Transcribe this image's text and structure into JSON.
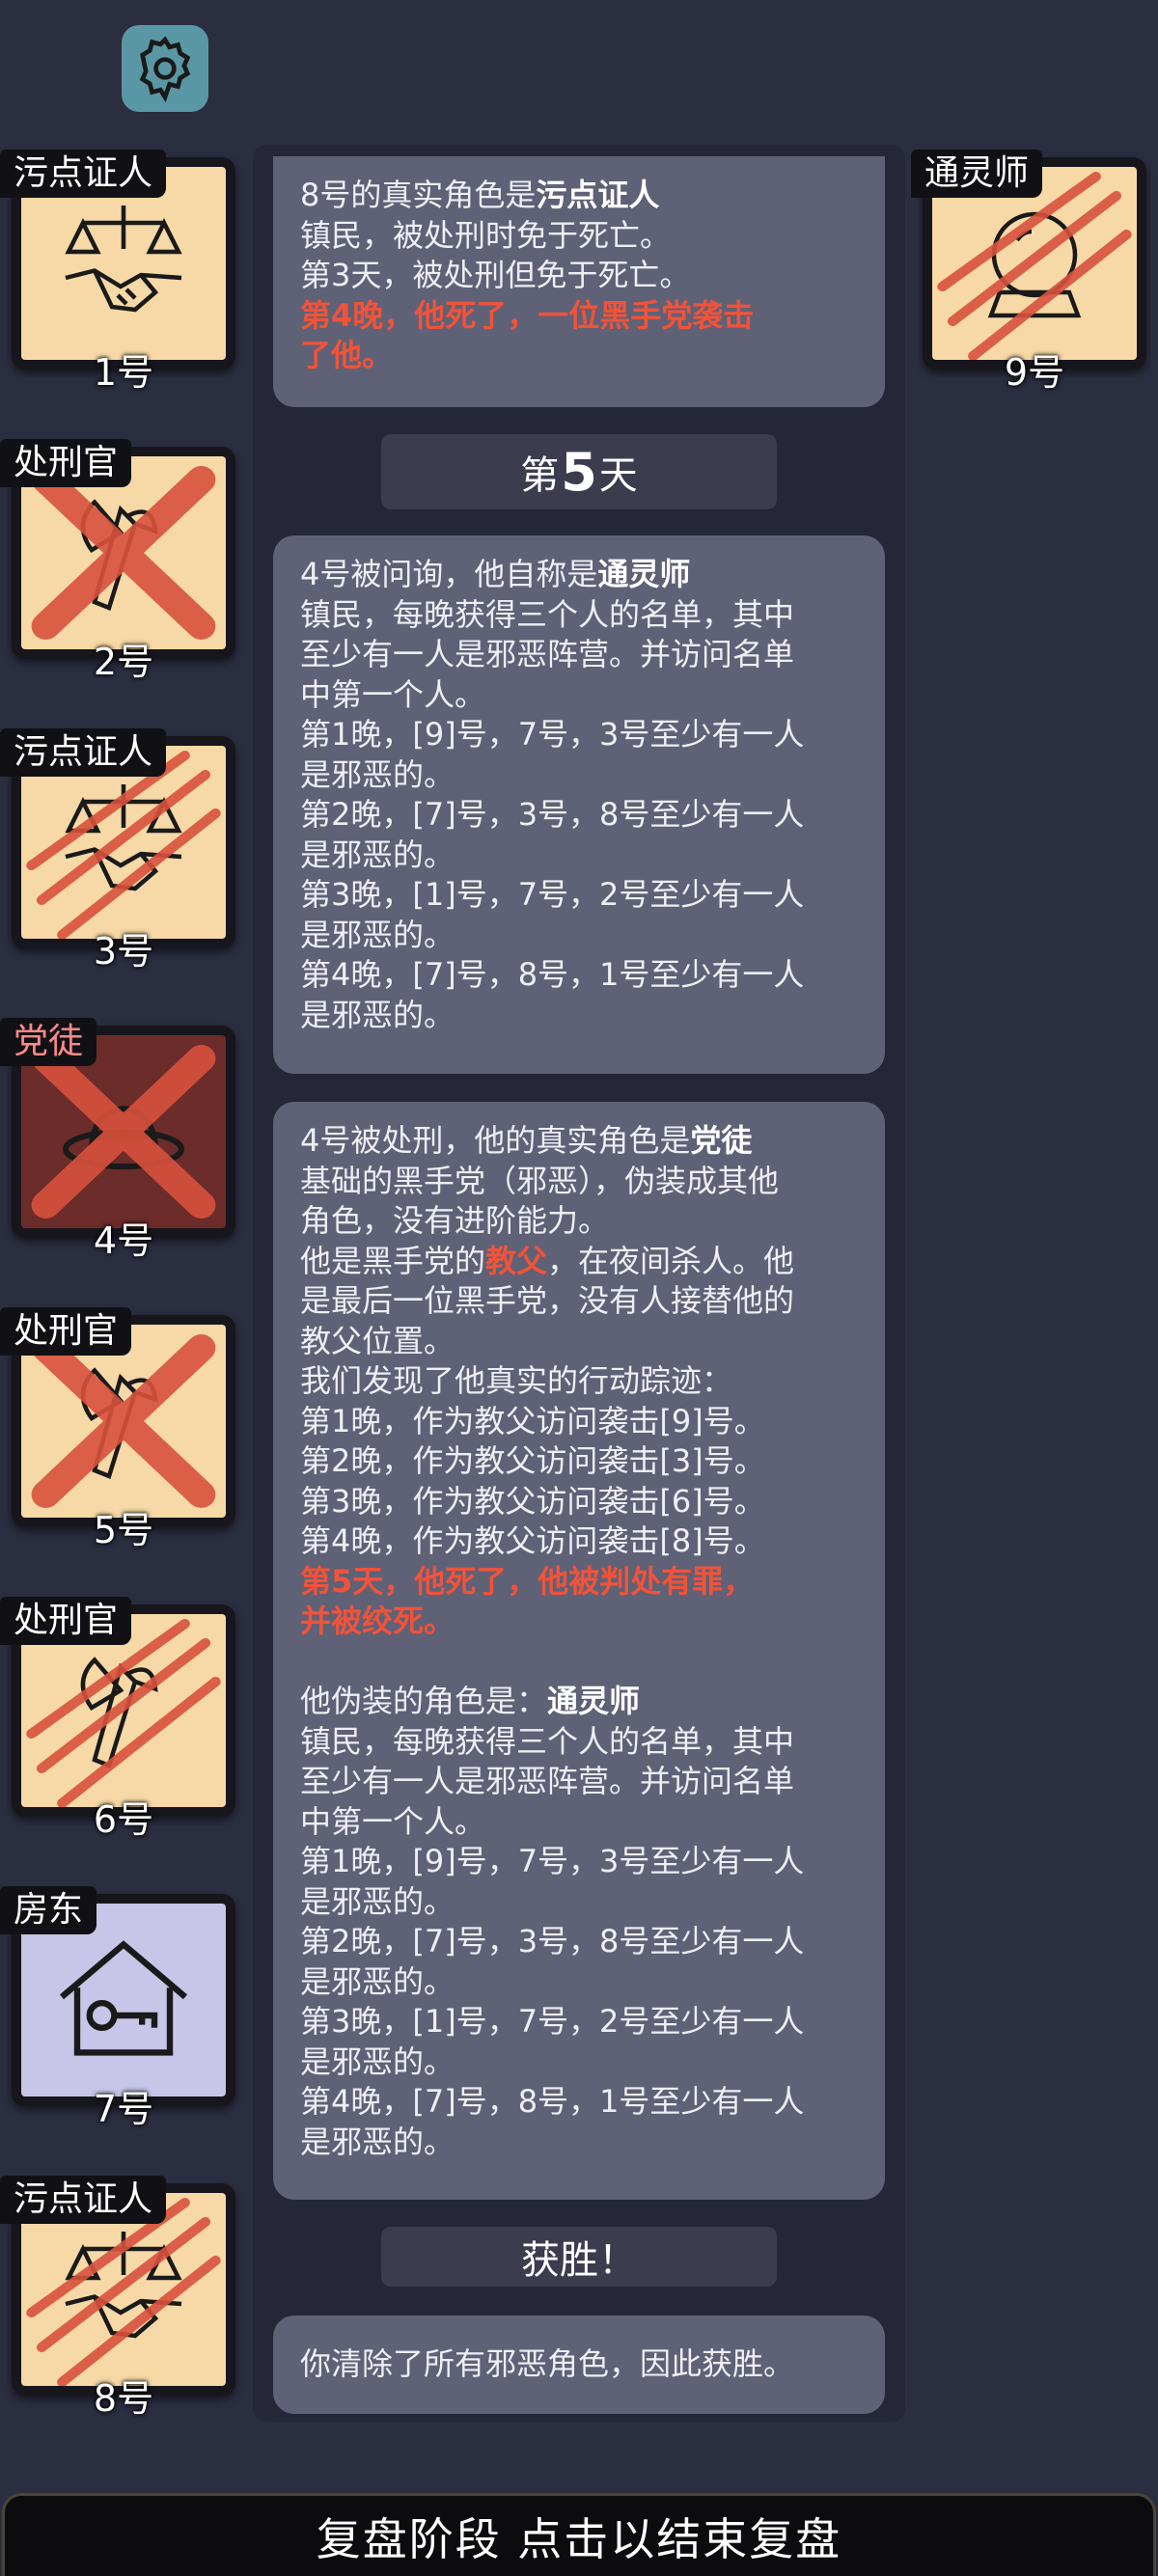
{
  "settings": {
    "icon": "gear-icon"
  },
  "players": [
    {
      "seat": "1号",
      "role": "污点证人",
      "icon": "handshake-scales-icon",
      "status": "alive"
    },
    {
      "seat": "2号",
      "role": "处刑官",
      "icon": "axe-icon",
      "status": "executed"
    },
    {
      "seat": "3号",
      "role": "污点证人",
      "icon": "handshake-scales-icon",
      "status": "killed"
    },
    {
      "seat": "4号",
      "role": "党徒",
      "icon": "fedora-hat-icon",
      "status": "executed"
    },
    {
      "seat": "5号",
      "role": "处刑官",
      "icon": "axe-icon",
      "status": "executed"
    },
    {
      "seat": "6号",
      "role": "处刑官",
      "icon": "axe-icon",
      "status": "killed"
    },
    {
      "seat": "7号",
      "role": "房东",
      "icon": "house-key-icon",
      "status": "alive"
    },
    {
      "seat": "8号",
      "role": "污点证人",
      "icon": "handshake-scales-icon",
      "status": "killed"
    },
    {
      "seat": "9号",
      "role": "通灵师",
      "icon": "crystal-ball-icon",
      "status": "killed"
    }
  ],
  "log": {
    "msg1": {
      "line1_prefix": "8号的真实角色是",
      "line1_role": "污点证人",
      "line2": "镇民，被处刑时免于死亡。",
      "line3": "第3天，被处刑但免于死亡。",
      "line4": "第4晚，他死了，一位黑手党袭击",
      "line5": "了他。"
    },
    "day5": {
      "prefix": "第",
      "number": "5",
      "suffix": "天"
    },
    "msg2": {
      "line1_prefix": "4号被问询，他自称是",
      "line1_role": "通灵师",
      "lines": [
        "镇民，每晚获得三个人的名单，其中",
        "至少有一人是邪恶阵营。并访问名单",
        "中第一个人。",
        "第1晚，[9]号，7号，3号至少有一人",
        "是邪恶的。",
        "第2晚，[7]号，3号，8号至少有一人",
        "是邪恶的。",
        "第3晚，[1]号，7号，2号至少有一人",
        "是邪恶的。",
        "第4晚，[7]号，8号，1号至少有一人",
        "是邪恶的。"
      ]
    },
    "msg3": {
      "line1_prefix": "4号被处刑，他的真实角色是",
      "line1_role": "党徒",
      "line2": "基础的黑手党（邪恶），伪装成其他",
      "line3": "角色，没有进阶能力。",
      "line4_prefix": "他是黑手党的",
      "line4_role": "教父",
      "line4_suffix": "，在夜间杀人。他",
      "line5": "是最后一位黑手党，没有人接替他的",
      "line6": "教父位置。",
      "line7": "我们发现了他真实的行动踪迹：",
      "actions": [
        "第1晚，作为教父访问袭击[9]号。",
        "第2晚，作为教父访问袭击[3]号。",
        "第3晚，作为教父访问袭击[6]号。",
        "第4晚，作为教父访问袭击[8]号。"
      ],
      "death1": "第5天，他死了，他被判处有罪，",
      "death2": "并被绞死。",
      "disguise_prefix": "他伪装的角色是：",
      "disguise_role": "通灵师",
      "disguise_lines": [
        "镇民，每晚获得三个人的名单，其中",
        "至少有一人是邪恶阵营。并访问名单",
        "中第一个人。",
        "第1晚，[9]号，7号，3号至少有一人",
        "是邪恶的。",
        "第2晚，[7]号，3号，8号至少有一人",
        "是邪恶的。",
        "第3晚，[1]号，7号，2号至少有一人",
        "是邪恶的。",
        "第4晚，[7]号，8号，1号至少有一人",
        "是邪恶的。"
      ]
    },
    "victory": "获胜！",
    "msg4": "你清除了所有邪恶角色，因此获胜。"
  },
  "bottom_bar": "复盘阶段 点击以结束复盘"
}
